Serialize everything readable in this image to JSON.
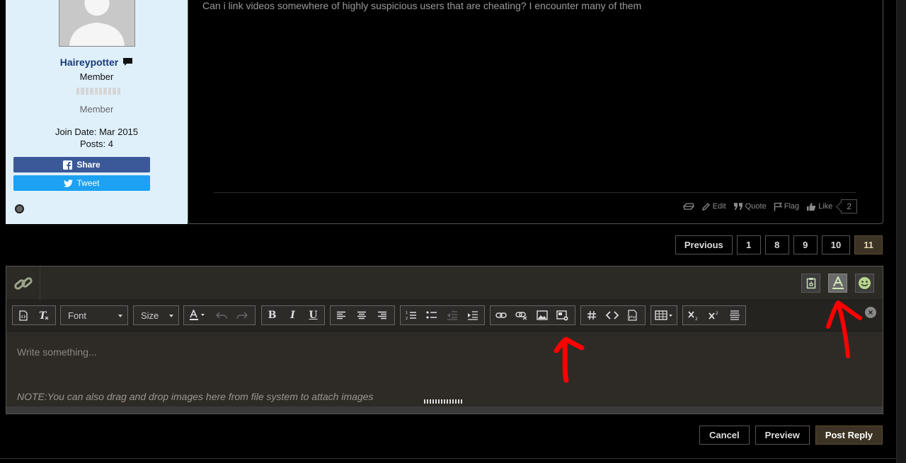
{
  "post": {
    "user": {
      "username": "Haireypotter",
      "title": "Member",
      "rank": "Member",
      "join_date": "Join Date: Mar 2015",
      "posts": "Posts: 4",
      "share_label": "Share",
      "tweet_label": "Tweet"
    },
    "message": "Can i link videos somewhere of highly suspicious users that are cheating? I encounter many of them",
    "actions": {
      "edit": "Edit",
      "quote": "Quote",
      "flag": "Flag",
      "like": "Like",
      "like_count": "2"
    }
  },
  "pagination": {
    "previous": "Previous",
    "pages": [
      "1",
      "8",
      "9",
      "10",
      "11"
    ],
    "current_page": "11"
  },
  "editor": {
    "font_label": "Font",
    "size_label": "Size",
    "placeholder": "Write something...",
    "note": "NOTE:You can also drag and drop images here from file system to attach images"
  },
  "buttons": {
    "cancel": "Cancel",
    "preview": "Preview",
    "post_reply": "Post Reply"
  },
  "colors": {
    "page_bg": "#000000",
    "userinfo_bg": "#dff0fb",
    "username": "#1a3a78",
    "facebook": "#3b5998",
    "twitter": "#1da1f2",
    "accent_button": "#3d3324",
    "annotation_arrow": "#ff0000"
  }
}
